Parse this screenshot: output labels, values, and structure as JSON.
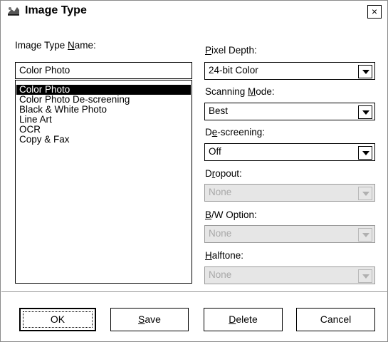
{
  "window": {
    "title": "Image Type",
    "close_label": "×"
  },
  "image_type_name": {
    "label_pre": "Image Type ",
    "label_mn": "N",
    "label_post": "ame:",
    "value": "Color Photo",
    "list": [
      "Color Photo",
      "Color Photo De-screening",
      "Black & White Photo",
      "Line Art",
      "OCR",
      "Copy & Fax"
    ],
    "selected_index": 0
  },
  "pixel_depth": {
    "label_mn": "P",
    "label_post": "ixel Depth:",
    "value": "24-bit Color"
  },
  "scanning_mode": {
    "label_pre": "Scanning ",
    "label_mn": "M",
    "label_post": "ode:",
    "value": "Best"
  },
  "descreening": {
    "label_pre": "D",
    "label_mn": "e",
    "label_post": "-screening:",
    "value": "Off"
  },
  "dropout": {
    "label_pre": "D",
    "label_mn": "r",
    "label_post": "opout:",
    "value": "None"
  },
  "bw_option": {
    "label_mn": "B",
    "label_post": "/W Option:",
    "value": "None"
  },
  "halftone": {
    "label_mn": "H",
    "label_post": "alftone:",
    "value": "None"
  },
  "buttons": {
    "ok": "OK",
    "save_mn": "S",
    "save_post": "ave",
    "delete_mn": "D",
    "delete_post": "elete",
    "cancel": "Cancel"
  }
}
